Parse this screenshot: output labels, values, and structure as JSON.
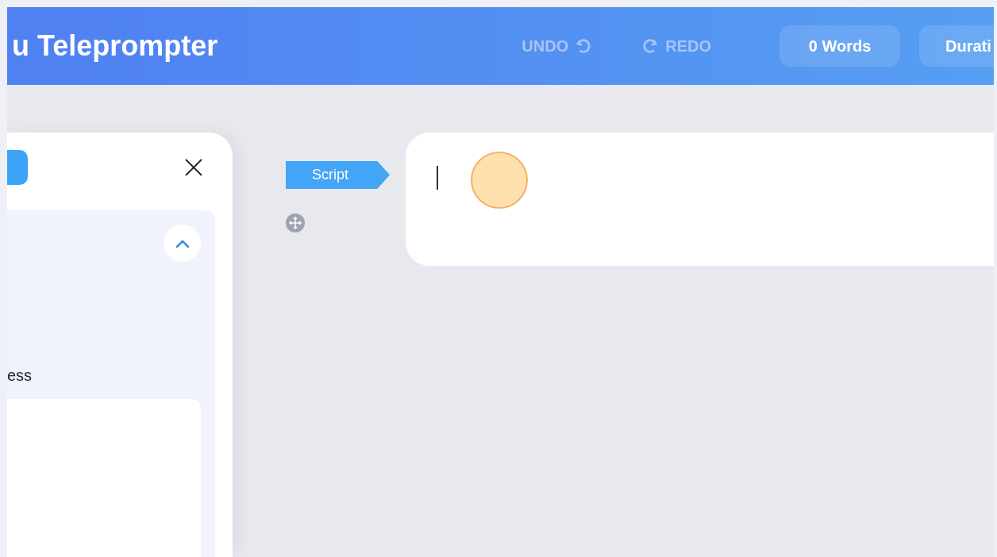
{
  "header": {
    "title": "u Teleprompter",
    "undo": {
      "label": "UNDO",
      "disabled": true
    },
    "redo": {
      "label": "REDO",
      "disabled": true
    },
    "word_count": "0 Words",
    "duration": "Durati"
  },
  "side_panel": {
    "section": {
      "expanded": true,
      "label": "ess"
    }
  },
  "script_tag": "Script"
}
